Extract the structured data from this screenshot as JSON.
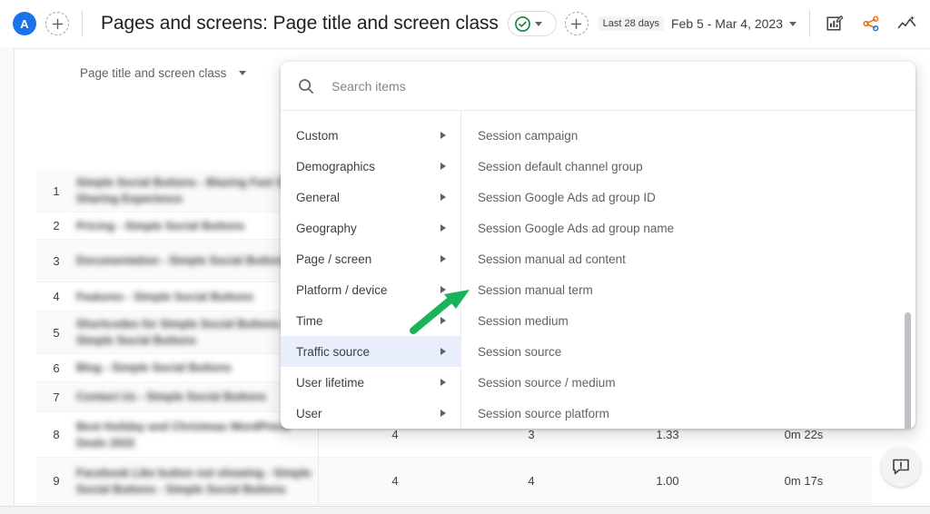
{
  "topbar": {
    "avatar_initial": "A",
    "add_label": "+",
    "title": "Pages and screens: Page title and screen class",
    "save_state_icon": "check-circle-icon",
    "date_chip": "Last 28 days",
    "date_range": "Feb 5 - Mar 4, 2023",
    "icons": [
      "edit-comparison-icon",
      "share-icon",
      "insights-icon"
    ]
  },
  "report": {
    "dimension_selector_label": "Page title and screen class"
  },
  "modal": {
    "search_placeholder": "Search items",
    "search_value": "",
    "search_icon": "search-icon",
    "categories": [
      {
        "label": "Custom",
        "selected": false
      },
      {
        "label": "Demographics",
        "selected": false
      },
      {
        "label": "General",
        "selected": false
      },
      {
        "label": "Geography",
        "selected": false
      },
      {
        "label": "Page / screen",
        "selected": false
      },
      {
        "label": "Platform / device",
        "selected": false
      },
      {
        "label": "Time",
        "selected": false
      },
      {
        "label": "Traffic source",
        "selected": true
      },
      {
        "label": "User lifetime",
        "selected": false
      },
      {
        "label": "User",
        "selected": false
      }
    ],
    "items": [
      "Session campaign",
      "Session default channel group",
      "Session Google Ads ad group ID",
      "Session Google Ads ad group name",
      "Session manual ad content",
      "Session manual term",
      "Session medium",
      "Session source",
      "Session source / medium",
      "Session source platform"
    ]
  },
  "table": {
    "rows": [
      {
        "n": "1",
        "dimension": "Simple Social Buttons - Blazing Fast Social Sharing Experience",
        "m1": "",
        "m2": "",
        "m3": "",
        "m4": ""
      },
      {
        "n": "2",
        "dimension": "Pricing - Simple Social Buttons",
        "m1": "",
        "m2": "",
        "m3": "",
        "m4": ""
      },
      {
        "n": "3",
        "dimension": "Documentation - Simple Social Buttons",
        "m1": "",
        "m2": "",
        "m3": "",
        "m4": ""
      },
      {
        "n": "4",
        "dimension": "Features - Simple Social Buttons",
        "m1": "",
        "m2": "",
        "m3": "",
        "m4": ""
      },
      {
        "n": "5",
        "dimension": "Shortcodes for Simple Social Buttons - Simple Social Buttons",
        "m1": "",
        "m2": "",
        "m3": "",
        "m4": ""
      },
      {
        "n": "6",
        "dimension": "Blog - Simple Social Buttons",
        "m1": "",
        "m2": "",
        "m3": "",
        "m4": ""
      },
      {
        "n": "7",
        "dimension": "Contact Us - Simple Social Buttons",
        "m1": "",
        "m2": "",
        "m3": "",
        "m4": ""
      },
      {
        "n": "8",
        "dimension": "Best Holiday and Christmas WordPress Deals 2022",
        "m1": "4",
        "m2": "3",
        "m3": "1.33",
        "m4": "0m 22s"
      },
      {
        "n": "9",
        "dimension": "Facebook Like button not showing - Simple Social Buttons - Simple Social Buttons",
        "m1": "4",
        "m2": "4",
        "m3": "1.00",
        "m4": "0m 17s"
      }
    ]
  },
  "annotation": {
    "arrow_color": "#19b35a",
    "points_to": "Session medium"
  },
  "feedback": {
    "icon": "feedback-icon"
  }
}
